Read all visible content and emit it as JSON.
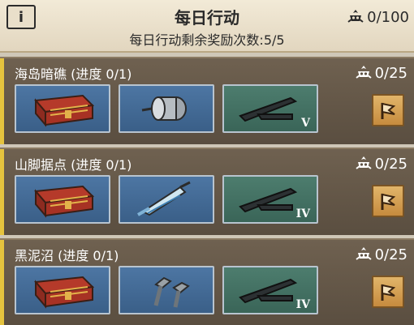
{
  "header": {
    "info_label": "i",
    "title": "每日行动",
    "subtitle": "每日行动剩余奖励次数:5/5",
    "total_points": "0/100"
  },
  "tasks": [
    {
      "title": "海岛暗礁 (进度 0/1)",
      "points": "0/25",
      "tier": "V"
    },
    {
      "title": "山脚据点 (进度 0/1)",
      "points": "0/25",
      "tier": "IV"
    },
    {
      "title": "黑泥沼 (进度 0/1)",
      "points": "0/25",
      "tier": "IV"
    }
  ],
  "items": {
    "slot1": "crate-icon",
    "slot2_task1": "motor-icon",
    "slot2_task2": "syringe-icon",
    "slot2_task3": "bolts-icon",
    "slot3": "gun-part-icon"
  },
  "colors": {
    "accent": "#e5c33e",
    "card": "#6a5c4b",
    "slot_blue": "#426a96",
    "slot_green": "#427264",
    "button": "#d39d50"
  }
}
